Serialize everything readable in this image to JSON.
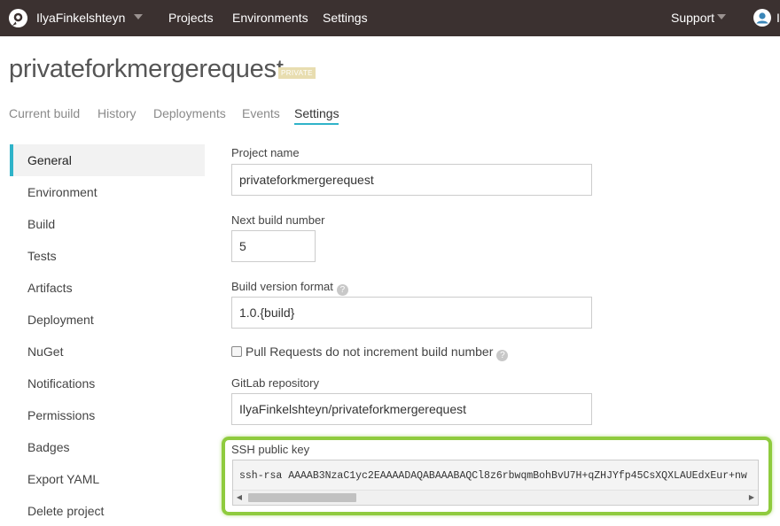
{
  "topnav": {
    "account": "IlyaFinkelshteyn",
    "links": [
      "Projects",
      "Environments",
      "Settings"
    ],
    "support": "Support",
    "user": "Il"
  },
  "project": {
    "title": "privateforkmergerequest",
    "badge": "PRIVATE"
  },
  "tabs": [
    "Current build",
    "History",
    "Deployments",
    "Events",
    "Settings"
  ],
  "active_tab": "Settings",
  "sidebar": {
    "active": "General",
    "items": [
      "General",
      "Environment",
      "Build",
      "Tests",
      "Artifacts",
      "Deployment",
      "NuGet",
      "Notifications",
      "Permissions",
      "Badges",
      "Export YAML",
      "Delete project"
    ]
  },
  "form": {
    "project_name_label": "Project name",
    "project_name_value": "privateforkmergerequest",
    "next_build_label": "Next build number",
    "next_build_value": "5",
    "version_format_label": "Build version format",
    "version_format_value": "1.0.{build}",
    "pr_checkbox_label": "Pull Requests do not increment build number",
    "pr_checkbox_checked": false,
    "repo_label": "GitLab repository",
    "repo_value": "IlyaFinkelshteyn/privateforkmergerequest",
    "ssh_label": "SSH public key",
    "ssh_value": "ssh-rsa AAAAB3NzaC1yc2EAAAADAQABAAABAQCl8z6rbwqmBohBvU7H+qZHJYfp45CsXQXLAUEdxEur+nw",
    "help_glyph": "?"
  },
  "colors": {
    "navbar": "#3b3130",
    "accent": "#2fb3c9",
    "highlight": "#8fcb3e",
    "badge": "#e8ddb0"
  }
}
